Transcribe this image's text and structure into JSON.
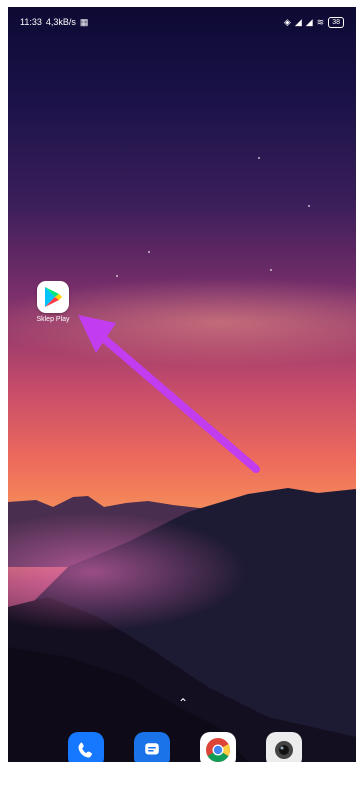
{
  "status_bar": {
    "time": "11:33",
    "network_speed": "4,3kB/s",
    "battery": "38"
  },
  "home_app": {
    "label": "Sklep Play",
    "icon": "play-store-icon"
  },
  "annotation": {
    "arrow_color": "#c23cf0"
  },
  "dock": {
    "items": [
      {
        "icon": "phone-icon",
        "color": "#1677ff"
      },
      {
        "icon": "messages-icon",
        "color": "#1a73e8"
      },
      {
        "icon": "chrome-icon",
        "color": "#ffffff"
      },
      {
        "icon": "camera-icon",
        "color": "#eeeeee"
      }
    ]
  }
}
